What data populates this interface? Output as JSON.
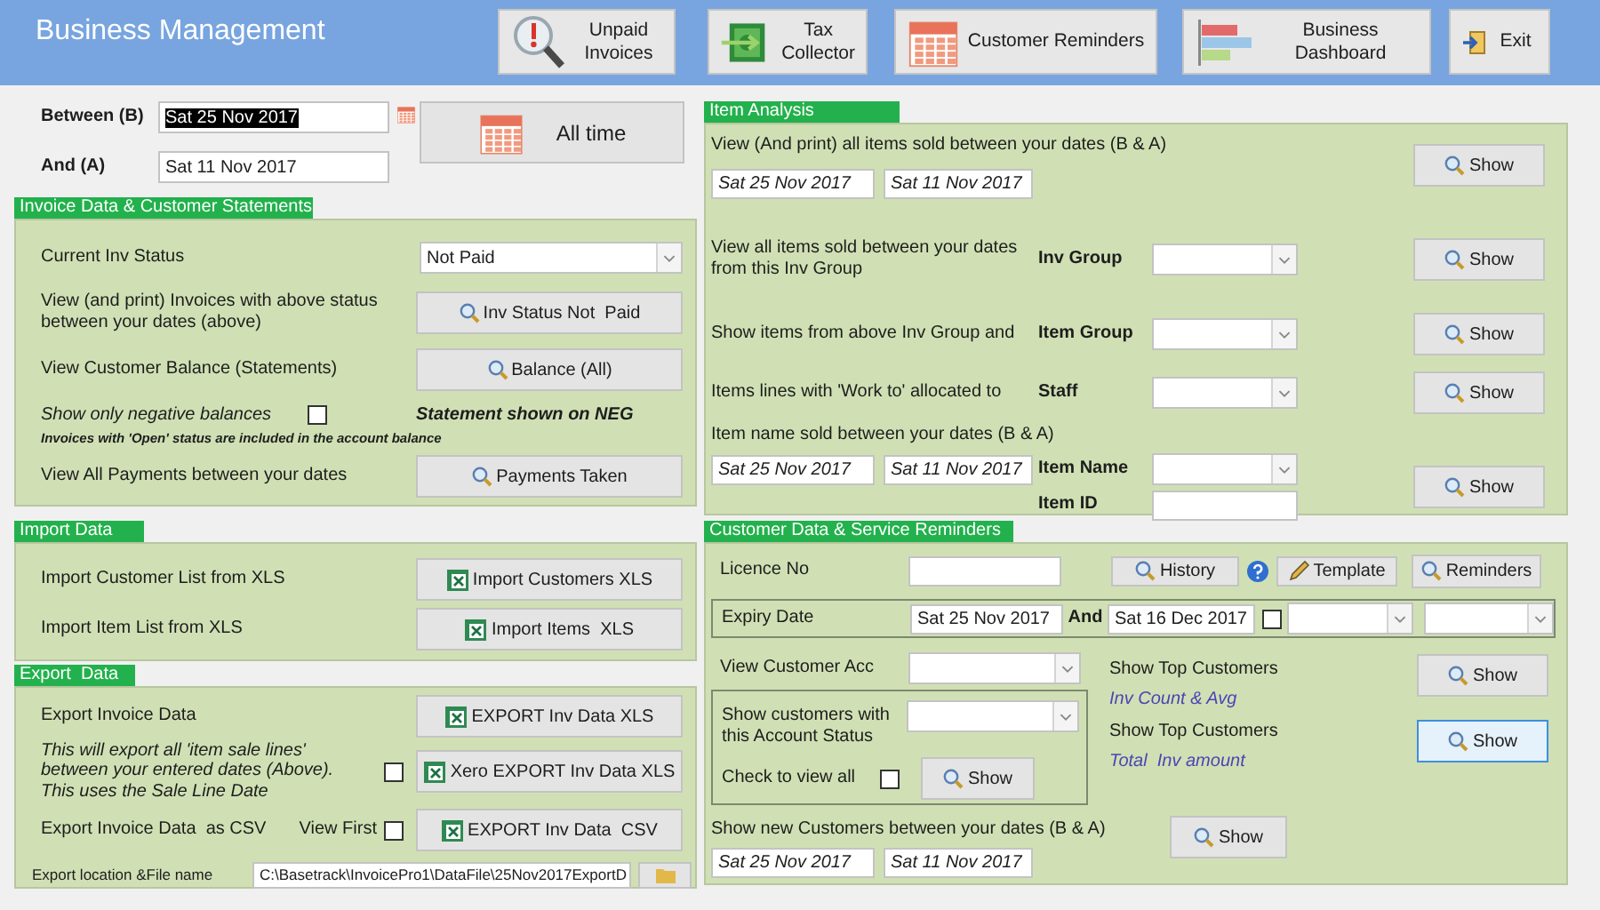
{
  "header": {
    "title": "Business Management",
    "buttons": [
      {
        "label": "Unpaid\nInvoices"
      },
      {
        "label": "Tax\nCollector"
      },
      {
        "label": "Customer Reminders"
      },
      {
        "label": "Business\nDashboard"
      },
      {
        "label": "Exit"
      }
    ]
  },
  "date_range": {
    "between_label": "Between (B)",
    "between_value": "Sat 25 Nov 2017",
    "between_highlighted": true,
    "and_label": "And (A)",
    "and_value": "Sat 11 Nov 2017",
    "all_time_button": "All time"
  },
  "invoice_panel": {
    "title": "Invoice Data & Customer Statements",
    "status_label": "Current Inv Status",
    "status_value": "Not Paid",
    "view_label": "View (and print) Invoices with above status between your dates (above)",
    "view_button": "Inv Status Not  Paid",
    "balance_label": "View Customer Balance (Statements)",
    "balance_button": "Balance (All)",
    "negative_label": "Show only negative balances",
    "negative_checked": false,
    "statement_note": "Statement shown on NEG",
    "open_note": "Invoices with 'Open' status are included in the account balance",
    "payments_label": "View All Payments between your dates",
    "payments_button": "Payments Taken"
  },
  "import_panel": {
    "title": "Import Data",
    "rows": [
      {
        "label": "Import Customer List from XLS",
        "button": "Import Customers XLS"
      },
      {
        "label": "Import Item List from XLS",
        "button": "Import Items  XLS"
      }
    ]
  },
  "export_panel": {
    "title": "Export  Data",
    "invoice_label": "Export Invoice Data",
    "xls_button": "EXPORT Inv Data XLS",
    "description": "This will export all 'item sale lines' between your entered dates (Above). This uses the Sale Line Date",
    "xero_checked": false,
    "xero_button": "Xero EXPORT Inv Data XLS",
    "csv_label": "Export Invoice Data  as CSV",
    "view_first_label": "View First",
    "view_first_checked": false,
    "csv_button": "EXPORT Inv Data  CSV",
    "location_label": "Export location &File name",
    "location_value": "C:\\Basetrack\\InvoicePro1\\DataFile\\25Nov2017ExportD"
  },
  "item_panel": {
    "title": "Item Analysis",
    "rows": [
      {
        "kind": "dates",
        "label": "View (And print) all items sold between your dates (B & A)",
        "from": "Sat 25 Nov 2017",
        "to": "Sat 11 Nov 2017",
        "button": "Show"
      },
      {
        "kind": "select",
        "label": "View all items sold between your dates from this Inv Group",
        "field_label": "Inv Group",
        "button": "Show"
      },
      {
        "kind": "select",
        "label": "Show items from above Inv Group and",
        "field_label": "Item Group",
        "button": "Show"
      },
      {
        "kind": "select",
        "label": "Items lines with 'Work to' allocated to",
        "field_label": "Staff",
        "button": "Show"
      },
      {
        "kind": "item",
        "label": "Item name sold between your dates (B & A)",
        "from": "Sat 25 Nov 2017",
        "to": "Sat 11 Nov 2017",
        "field_label": "Item Name",
        "id_label": "Item ID",
        "button": "Show"
      }
    ]
  },
  "customer_panel": {
    "title": "Customer Data & Service Reminders",
    "licence_label": "Licence No",
    "history_button": "History",
    "template_button": "Template",
    "reminders_button": "Reminders",
    "expiry_label": "Expiry Date",
    "expiry_from": "Sat 25 Nov 2017",
    "and_label": "And",
    "expiry_to": "Sat 16 Dec 2017",
    "expiry_checked": false,
    "account_label": "View Customer Acc",
    "status_label": "Show customers with this Account Status",
    "status_button": "Show",
    "view_all_label": "Check to view all",
    "view_all_checked": false,
    "top": [
      {
        "label": "Show Top Customers",
        "note": "Inv Count & Avg",
        "button": "Show",
        "focused": false
      },
      {
        "label": "Show Top Customers",
        "note": "Total  Inv amount",
        "button": "Show",
        "focused": true
      }
    ],
    "new_label": "Show new Customers between your dates (B & A)",
    "new_button": "Show",
    "new_from": "Sat 25 Nov 2017",
    "new_to": "Sat 11 Nov 2017"
  }
}
